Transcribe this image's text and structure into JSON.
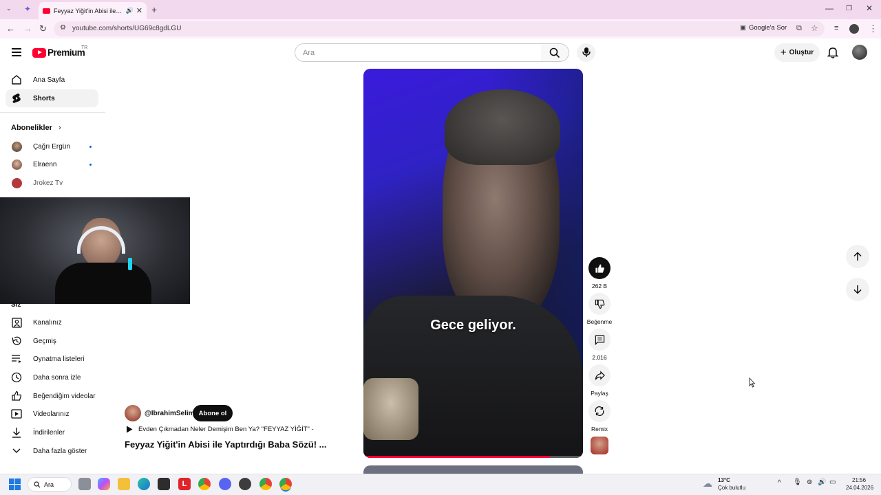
{
  "browser": {
    "tab_title": "Feyyaz Yiğit'in Abisi ile Yaptı",
    "url": "youtube.com/shorts/UG69c8gdLGU",
    "google_chip": "Google'a Sor"
  },
  "header": {
    "logo_text": "Premium",
    "country": "TR",
    "search_placeholder": "Ara",
    "create_label": "Oluştur"
  },
  "sidebar": {
    "main": [
      {
        "label": "Ana Sayfa",
        "icon": "home-icon"
      },
      {
        "label": "Shorts",
        "icon": "shorts-icon"
      }
    ],
    "subs_title": "Abonelikler",
    "subs": [
      {
        "label": "Çağrı Ergün"
      },
      {
        "label": "Elraenn"
      },
      {
        "label": "Jrokez Tv"
      }
    ],
    "you_title": "Siz",
    "you": [
      {
        "label": "Kanalınız",
        "icon": "channel-icon"
      },
      {
        "label": "Geçmiş",
        "icon": "history-icon"
      },
      {
        "label": "Oynatma listeleri",
        "icon": "playlist-icon"
      },
      {
        "label": "Daha sonra izle",
        "icon": "clock-icon"
      },
      {
        "label": "Beğendiğim videolar",
        "icon": "like-icon"
      },
      {
        "label": "Videolarınız",
        "icon": "video-icon"
      },
      {
        "label": "İndirilenler",
        "icon": "download-icon"
      },
      {
        "label": "Daha fazla göster",
        "icon": "chevron-down-icon"
      }
    ]
  },
  "short": {
    "caption": "Gece geliyor.",
    "channel": "@IbrahimSelim",
    "subscribe": "Abone ol",
    "playlist": "Evden Çıkmadan Neler Demişim Ben Ya? \"FEYYAZ YİĞİT\" -",
    "title": "Feyyaz Yiğit'in Abisi ile Yaptırdığı Baba Sözü! ...",
    "progress": 0.85
  },
  "actions": {
    "likes": "262 B",
    "dislike": "Beğenme",
    "comments": "2.016",
    "share": "Paylaş",
    "remix": "Remix"
  },
  "taskbar": {
    "search": "Ara",
    "weather_temp": "13°C",
    "weather_desc": "Çok bulutlu",
    "time": "21:56",
    "date": "24.04.2026"
  },
  "colors": {
    "accent": "#ff0033",
    "tabstrip": "#f3d9ee"
  }
}
